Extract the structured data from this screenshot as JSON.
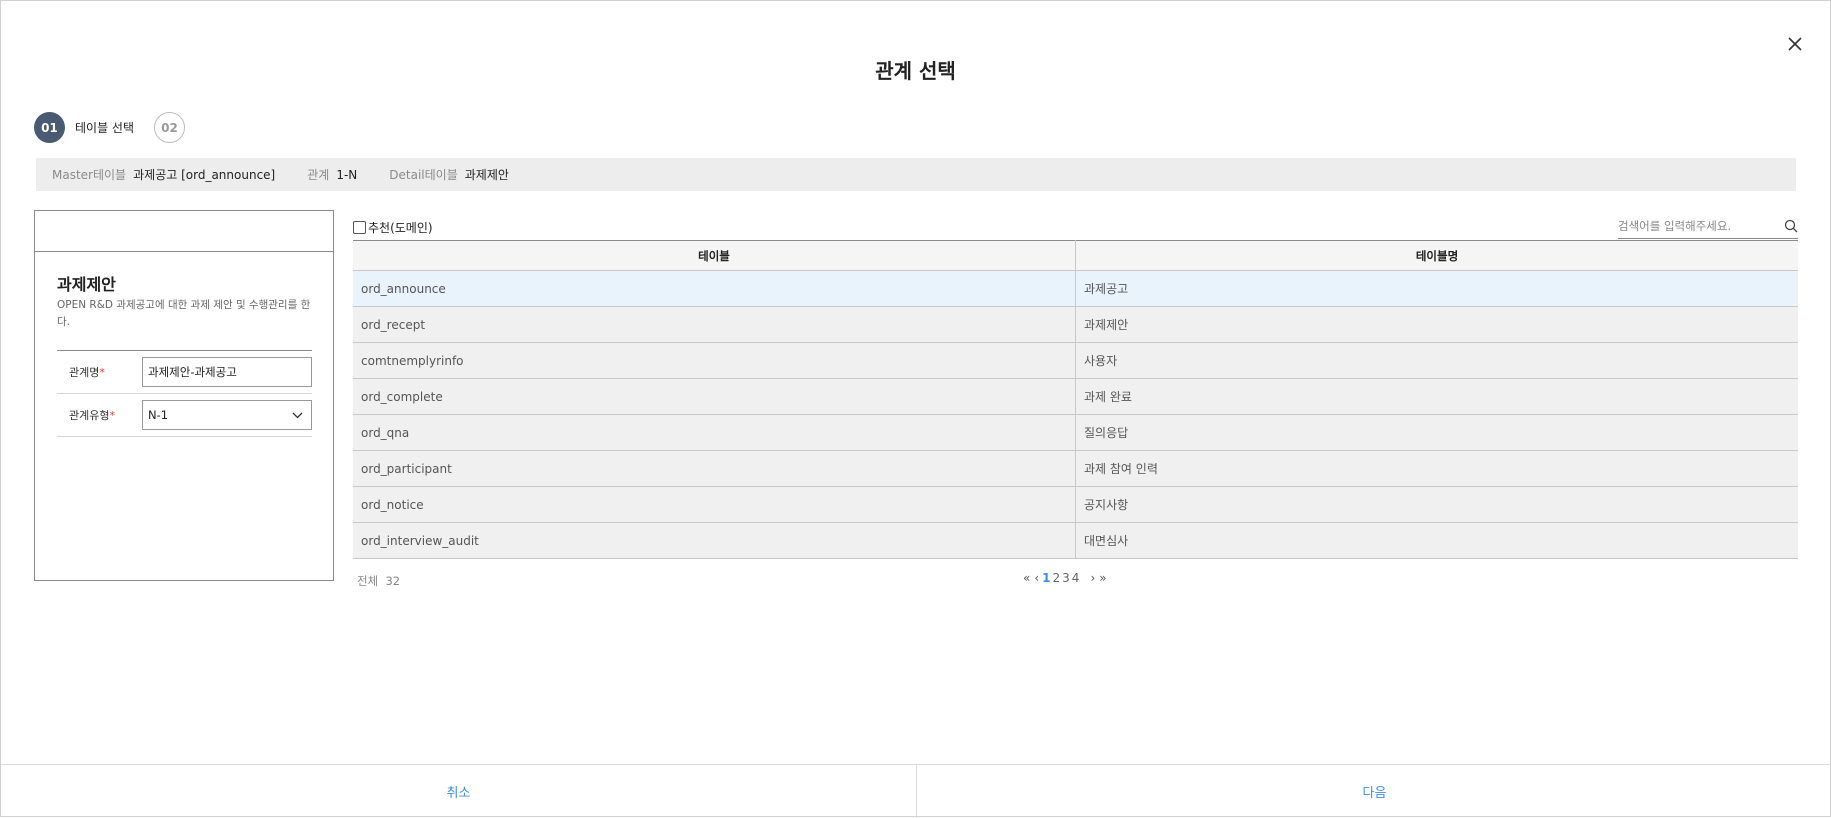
{
  "modal": {
    "title": "관계 선택"
  },
  "steps": [
    {
      "num": "01",
      "label": "테이블 선택"
    },
    {
      "num": "02"
    }
  ],
  "info": {
    "master_key": "Master테이블",
    "master_val": "과제공고 [ord_announce]",
    "rel_key": "관계",
    "rel_val": "1-N",
    "detail_key": "Detail테이블",
    "detail_val": "과제제안"
  },
  "left": {
    "name": "과제제안",
    "desc": "OPEN R&D 과제공고에 대한 과제 제안 및 수행관리를 한다.",
    "rel_name_label": "관계명",
    "rel_name_value": "과제제안-과제공고",
    "rel_type_label": "관계유형",
    "rel_type_value": "N-1",
    "required_mark": "*"
  },
  "toolbar": {
    "recommend_label": "추천(도메인)",
    "search_placeholder": "검색어를 입력해주세요."
  },
  "table": {
    "headers": [
      "테이블",
      "테이블명"
    ],
    "rows": [
      [
        "ord_announce",
        "과제공고"
      ],
      [
        "ord_recept",
        "과제제안"
      ],
      [
        "comtnemplyrinfo",
        "사용자"
      ],
      [
        "ord_complete",
        "과제 완료"
      ],
      [
        "ord_qna",
        "질의응답"
      ],
      [
        "ord_participant",
        "과제 참여 인력"
      ],
      [
        "ord_notice",
        "공지사항"
      ],
      [
        "ord_interview_audit",
        "대면심사"
      ]
    ]
  },
  "pagination": {
    "total_label": "전체",
    "total": "32",
    "pages": [
      "1",
      "2",
      "3",
      "4"
    ],
    "current": "1"
  },
  "buttons": {
    "cancel": "취소",
    "next": "다음"
  },
  "colors": {
    "accent": "#3d8fe0",
    "step_active": "#4a5a73",
    "selected_row": "#e8f3fc"
  }
}
